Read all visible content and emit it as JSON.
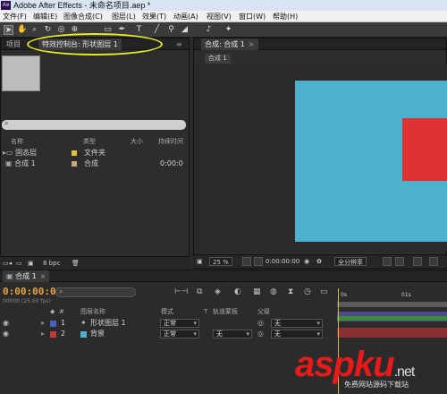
{
  "titlebar": {
    "logo": "Ae",
    "title": "Adobe After Effects - 未命名项目.aep *"
  },
  "menu": [
    "文件(F)",
    "编辑(E)",
    "图像合成(C)",
    "图层(L)",
    "效果(T)",
    "动画(A)",
    "视图(V)",
    "窗口(W)",
    "帮助(H)"
  ],
  "left_panel": {
    "tab_project": "项目",
    "tab_effects": "特效控制台: 形状图层 1",
    "columns": [
      "名称",
      "类型",
      "大小",
      "持续时间"
    ],
    "items": [
      {
        "name": "固态层",
        "type": "文件夹",
        "duration": "",
        "color": "#e0c23c"
      },
      {
        "name": "合成 1",
        "type": "合成",
        "duration": "0:00:0",
        "color": "#c8a57a"
      }
    ],
    "bpc": "8 bpc"
  },
  "comp_panel": {
    "tab": "合成: 合成 1",
    "subtab": "合成 1",
    "zoom": "25 %",
    "timecode": "0:00:00:00",
    "resolution": "全分辨率"
  },
  "timeline": {
    "tab": "合成 1",
    "timecode": "0:00:00:00",
    "fps": "00000 (25.00 fps)",
    "columns": {
      "name": "图层名称",
      "mode": "模式",
      "t": "T",
      "trkmat": "轨道蒙板",
      "parent": "父级"
    },
    "layers": [
      {
        "num": "1",
        "name": "形状图层 1",
        "mode": "正常",
        "trkmat": "",
        "parent": "无",
        "color": "#4a5fc1"
      },
      {
        "num": "2",
        "name": "背景",
        "mode": "正常",
        "trkmat": "无",
        "parent": "无",
        "color": "#c13a3a"
      }
    ],
    "ruler": [
      "0s",
      "01s"
    ]
  },
  "watermark": {
    "main": "aspku",
    "suffix": ".net",
    "sub": "免费网站源码下载站"
  },
  "colors": {
    "annotation": "#e6e82a",
    "background_layer": "#4db1cd",
    "shape_layer": "#dd3333",
    "timecode": "#e8a33c"
  }
}
